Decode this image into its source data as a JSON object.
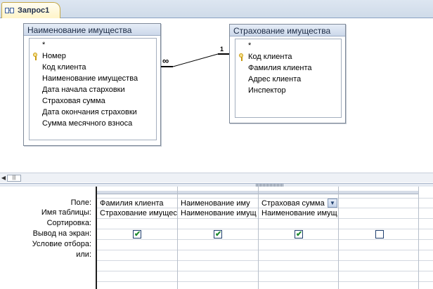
{
  "tab": {
    "label": "Запрос1"
  },
  "tables": [
    {
      "title": "Наименование имущества",
      "fields": [
        "*",
        "Номер",
        "Код клиента",
        "Наименование имущества",
        "Дата начала старховки",
        "Страховая сумма",
        "Дата окончания страховки",
        "Сумма месячного взноса"
      ],
      "key_field": "Номер"
    },
    {
      "title": "Страхование имущества",
      "fields": [
        "*",
        "Код клиента",
        "Фамилия клиента",
        "Адрес клиента",
        "Инспектор"
      ],
      "key_field": "Код клиента"
    }
  ],
  "relationship": {
    "many_symbol": "∞",
    "one_symbol": "1"
  },
  "grid": {
    "row_labels": [
      "Поле:",
      "Имя таблицы:",
      "Сортировка:",
      "Вывод на экран:",
      "Условие отбора:",
      "или:"
    ],
    "columns": [
      {
        "field": "Фамилия клиента",
        "table": "Страхование имущес",
        "show": true
      },
      {
        "field": "Наименование иму",
        "table": "Наименование имущ",
        "show": true
      },
      {
        "field": "Страховая сумма",
        "table": "Наименование имущ",
        "show": true,
        "dropdown_icon": "chevron-down-icon"
      },
      {
        "field": "",
        "table": "",
        "show": false
      }
    ]
  },
  "colors": {
    "accent": "#c5a847",
    "border": "#7f8a99",
    "check": "#1d8a2e"
  }
}
